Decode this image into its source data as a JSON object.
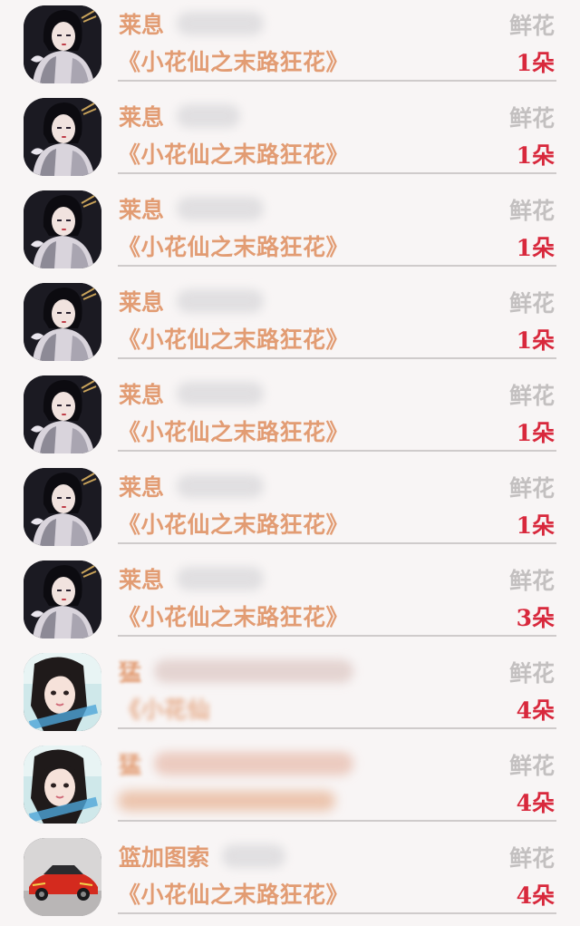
{
  "gift_list": {
    "items": [
      {
        "sender": "莱息",
        "book": "《小花仙之末路狂花》",
        "gift": "鲜花",
        "count": "1朵",
        "avatar": "anime-girl-avatar",
        "redacted": false
      },
      {
        "sender": "莱息",
        "book": "《小花仙之末路狂花》",
        "gift": "鲜花",
        "count": "1朵",
        "avatar": "anime-girl-avatar",
        "redacted": false
      },
      {
        "sender": "莱息",
        "book": "《小花仙之末路狂花》",
        "gift": "鲜花",
        "count": "1朵",
        "avatar": "anime-girl-avatar",
        "redacted": false
      },
      {
        "sender": "莱息",
        "book": "《小花仙之末路狂花》",
        "gift": "鲜花",
        "count": "1朵",
        "avatar": "anime-girl-avatar",
        "redacted": false
      },
      {
        "sender": "莱息",
        "book": "《小花仙之末路狂花》",
        "gift": "鲜花",
        "count": "1朵",
        "avatar": "anime-girl-avatar",
        "redacted": false
      },
      {
        "sender": "莱息",
        "book": "《小花仙之末路狂花》",
        "gift": "鲜花",
        "count": "1朵",
        "avatar": "anime-girl-avatar",
        "redacted": false
      },
      {
        "sender": "莱息",
        "book": "《小花仙之末路狂花》",
        "gift": "鲜花",
        "count": "3朵",
        "avatar": "anime-girl-avatar",
        "redacted": false
      },
      {
        "sender": "猛",
        "book": "《小花仙",
        "gift": "鲜花",
        "count": "4朵",
        "avatar": "photo-girl-avatar",
        "redacted": true
      },
      {
        "sender": "猛",
        "book": "",
        "gift": "鲜花",
        "count": "4朵",
        "avatar": "photo-girl-avatar",
        "redacted": true
      },
      {
        "sender": "篮加图索",
        "book": "《小花仙之末路狂花》",
        "gift": "鲜花",
        "count": "4朵",
        "avatar": "red-car-avatar",
        "redacted": false
      }
    ]
  },
  "colors": {
    "background": "#f8f5f5",
    "text_orange": "#e29c73",
    "gift_label_gray": "#c3c0c0",
    "count_red": "#d8283c",
    "divider": "#cfcbcb"
  }
}
